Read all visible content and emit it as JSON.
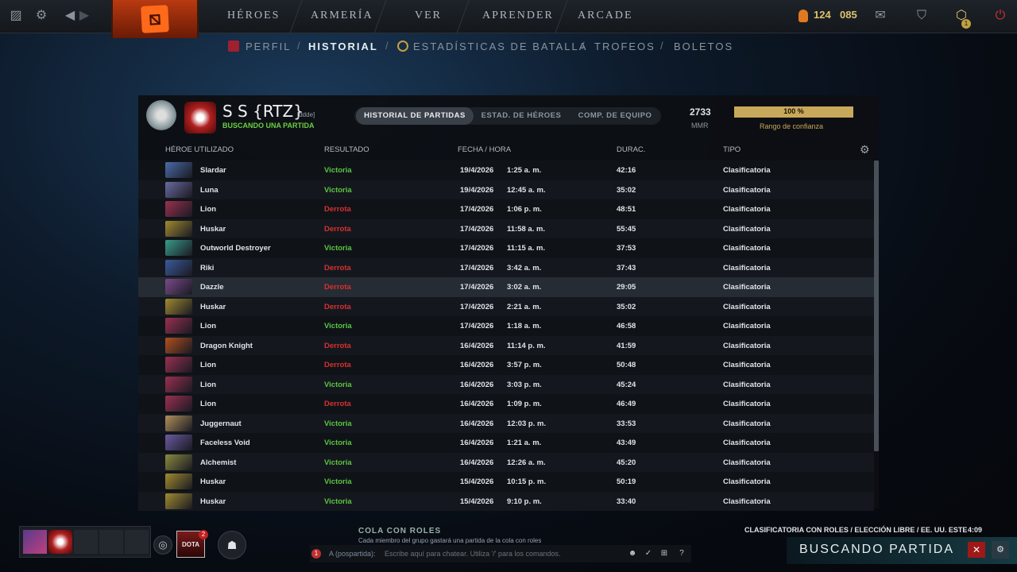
{
  "topbar": {
    "nav": [
      "HÉROES",
      "ARMERÍA",
      "VER",
      "APRENDER",
      "ARCADE"
    ],
    "currency1": "124",
    "currency2": "085",
    "notif_count": "1"
  },
  "subnav": [
    "PERFIL",
    "HISTORIAL",
    "ESTADÍSTICAS DE BATALLA",
    "TROFEOS",
    "BOLETOS"
  ],
  "profile": {
    "name": "S S {RTZ}",
    "tag": "[ddde]",
    "status": "BUSCANDO UNA PARTIDA",
    "tabs": [
      "HISTORIAL DE PARTIDAS",
      "ESTAD. DE HÉROES",
      "COMP. DE EQUIPO"
    ],
    "mmr": "2733",
    "mmr_label": "MMR",
    "confidence": 1.0,
    "confidence_text": "100 %",
    "confidence_label": "Rango de confianza"
  },
  "table": {
    "headers": [
      "HÉROE UTILIZADO",
      "RESULTADO",
      "FECHA / HORA",
      "DURAC.",
      "TIPO"
    ],
    "rows": [
      {
        "hero": "Slardar",
        "result": "Victoria",
        "win": true,
        "date": "19/4/2026",
        "time": "1:25 a. m.",
        "dur": "42:16",
        "type": "Clasificatoria",
        "color": "#4a6aa8"
      },
      {
        "hero": "Luna",
        "result": "Victoria",
        "win": true,
        "date": "19/4/2026",
        "time": "12:45 a. m.",
        "dur": "35:02",
        "type": "Clasificatoria",
        "color": "#6a6aa0"
      },
      {
        "hero": "Lion",
        "result": "Derrota",
        "win": false,
        "date": "17/4/2026",
        "time": "1:06 p. m.",
        "dur": "48:51",
        "type": "Clasificatoria",
        "color": "#9a3050"
      },
      {
        "hero": "Huskar",
        "result": "Derrota",
        "win": false,
        "date": "17/4/2026",
        "time": "11:58 a. m.",
        "dur": "55:45",
        "type": "Clasificatoria",
        "color": "#a08a30"
      },
      {
        "hero": "Outworld Destroyer",
        "result": "Victoria",
        "win": true,
        "date": "17/4/2026",
        "time": "11:15 a. m.",
        "dur": "37:53",
        "type": "Clasificatoria",
        "color": "#3a9a8a"
      },
      {
        "hero": "Riki",
        "result": "Derrota",
        "win": false,
        "date": "17/4/2026",
        "time": "3:42 a. m.",
        "dur": "37:43",
        "type": "Clasificatoria",
        "color": "#3a5a9a"
      },
      {
        "hero": "Dazzle",
        "result": "Derrota",
        "win": false,
        "date": "17/4/2026",
        "time": "3:02 a. m.",
        "dur": "29:05",
        "type": "Clasificatoria",
        "color": "#7a4a8a"
      },
      {
        "hero": "Huskar",
        "result": "Derrota",
        "win": false,
        "date": "17/4/2026",
        "time": "2:21 a. m.",
        "dur": "35:02",
        "type": "Clasificatoria",
        "color": "#a08a30"
      },
      {
        "hero": "Lion",
        "result": "Victoria",
        "win": true,
        "date": "17/4/2026",
        "time": "1:18 a. m.",
        "dur": "46:58",
        "type": "Clasificatoria",
        "color": "#9a3050"
      },
      {
        "hero": "Dragon Knight",
        "result": "Derrota",
        "win": false,
        "date": "16/4/2026",
        "time": "11:14 p. m.",
        "dur": "41:59",
        "type": "Clasificatoria",
        "color": "#b05020"
      },
      {
        "hero": "Lion",
        "result": "Derrota",
        "win": false,
        "date": "16/4/2026",
        "time": "3:57 p. m.",
        "dur": "50:48",
        "type": "Clasificatoria",
        "color": "#9a3050"
      },
      {
        "hero": "Lion",
        "result": "Victoria",
        "win": true,
        "date": "16/4/2026",
        "time": "3:03 p. m.",
        "dur": "45:24",
        "type": "Clasificatoria",
        "color": "#9a3050"
      },
      {
        "hero": "Lion",
        "result": "Derrota",
        "win": false,
        "date": "16/4/2026",
        "time": "1:09 p. m.",
        "dur": "46:49",
        "type": "Clasificatoria",
        "color": "#9a3050"
      },
      {
        "hero": "Juggernaut",
        "result": "Victoria",
        "win": true,
        "date": "16/4/2026",
        "time": "12:03 p. m.",
        "dur": "33:53",
        "type": "Clasificatoria",
        "color": "#b0905a"
      },
      {
        "hero": "Faceless Void",
        "result": "Victoria",
        "win": true,
        "date": "16/4/2026",
        "time": "1:21 a. m.",
        "dur": "43:49",
        "type": "Clasificatoria",
        "color": "#6a5aa0"
      },
      {
        "hero": "Alchemist",
        "result": "Victoria",
        "win": true,
        "date": "16/4/2026",
        "time": "12:26 a. m.",
        "dur": "45:20",
        "type": "Clasificatoria",
        "color": "#8a8a40"
      },
      {
        "hero": "Huskar",
        "result": "Victoria",
        "win": true,
        "date": "15/4/2026",
        "time": "10:15 p. m.",
        "dur": "50:19",
        "type": "Clasificatoria",
        "color": "#a08a30"
      },
      {
        "hero": "Huskar",
        "result": "Victoria",
        "win": true,
        "date": "15/4/2026",
        "time": "9:10 p. m.",
        "dur": "33:40",
        "type": "Clasificatoria",
        "color": "#a08a30"
      }
    ]
  },
  "bottom": {
    "dota_plus": "DOTA",
    "dota_plus_badge": "2",
    "queue_title": "COLA CON ROLES",
    "queue_desc": "Cada miembro del grupo gastará una partida de la cola con roles",
    "chat_alert": "1",
    "chat_channel": "A (pospartida):",
    "chat_placeholder": "Escribe aquí para chatear. Utiliza '/' para los comandos.",
    "match_info": "CLASIFICATORIA CON ROLES / ELECCIÓN LIBRE / EE. UU. ESTE",
    "timer": "4:09",
    "search_label": "BUSCANDO PARTIDA"
  }
}
